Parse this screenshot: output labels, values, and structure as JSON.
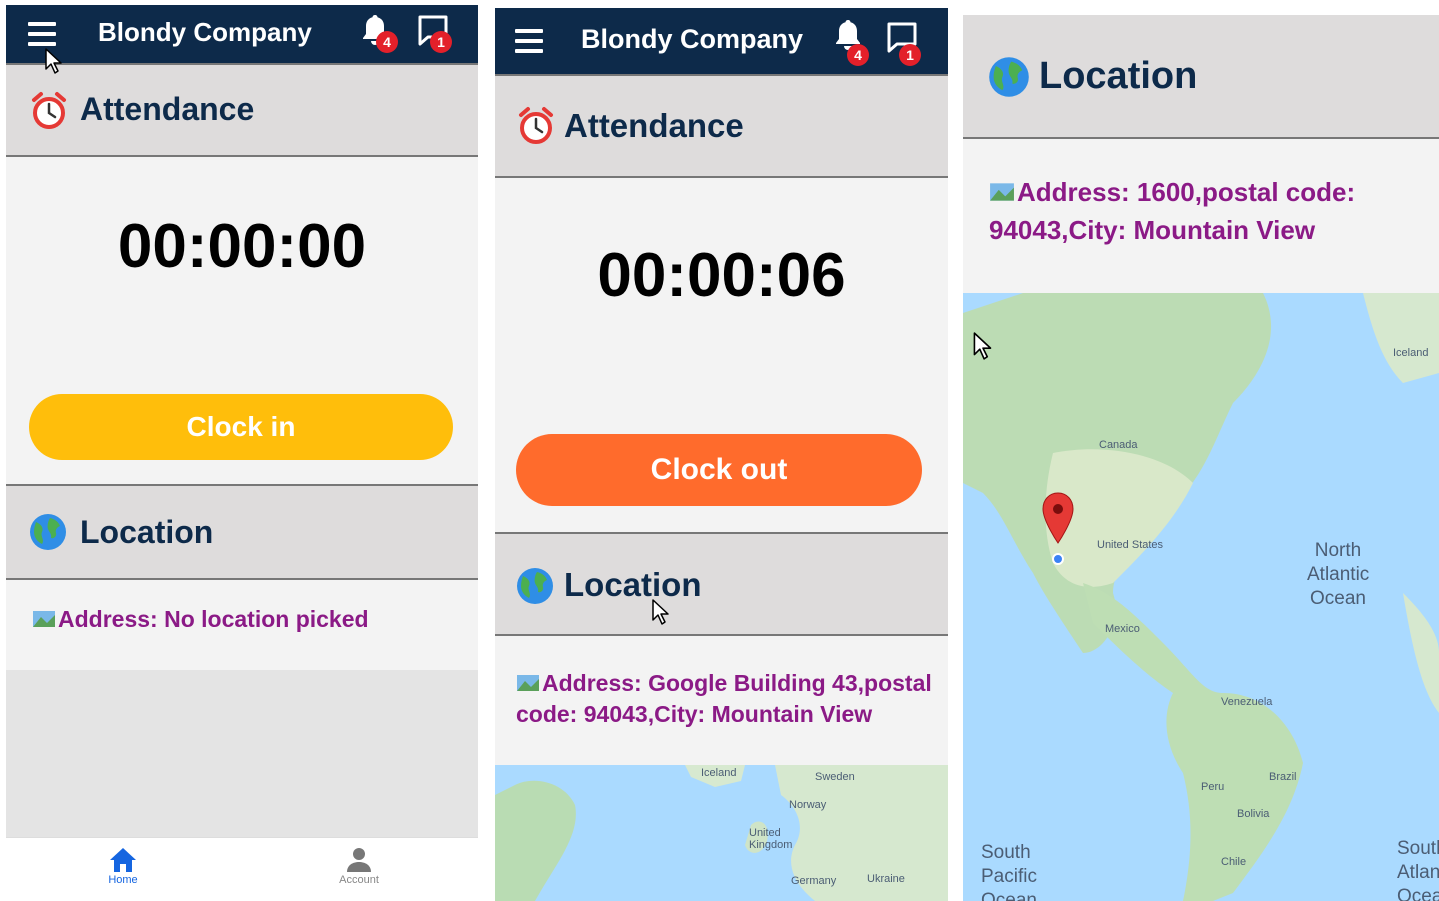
{
  "app": {
    "company": "Blondy Company"
  },
  "badges": {
    "notifications": "4",
    "messages": "1"
  },
  "attendance": {
    "title": "Attendance"
  },
  "location": {
    "title": "Location"
  },
  "screen1": {
    "timer": "00:00:00",
    "button": "Clock in",
    "address": "Address: No location picked"
  },
  "screen2": {
    "timer": "00:00:06",
    "button": "Clock out",
    "address": "Address: Google Building 43,postal code: 94043,City: Mountain View",
    "map_labels": {
      "iceland": "Iceland",
      "sweden": "Sweden",
      "norway": "Norway",
      "uk": "United Kingdom",
      "germany": "Germany",
      "ukraine": "Ukraine"
    }
  },
  "screen3": {
    "address": "Address: 1600,postal code: 94043,City: Mountain View",
    "map_labels": {
      "iceland": "Iceland",
      "canada": "Canada",
      "us": "United States",
      "mexico": "Mexico",
      "north_atlantic": "North Atlantic Ocean",
      "venezuela": "Venezuela",
      "brazil": "Brazil",
      "peru": "Peru",
      "bolivia": "Bolivia",
      "chile": "Chile",
      "south_pacific": "South Pacific Ocean",
      "south_atlantic": "South Atlantic Ocean"
    }
  },
  "nav": {
    "home": "Home",
    "account": "Account"
  },
  "icons": {
    "menu": "hamburger-menu-icon",
    "bell": "bell-icon",
    "chat": "chat-icon",
    "alarm": "alarm-clock-icon",
    "globe": "globe-icon",
    "map": "map-icon",
    "home": "home-icon",
    "account": "account-icon",
    "pin": "map-pin-icon"
  },
  "colors": {
    "appbar": "#0d2a4a",
    "clock_in": "#ffbe0b",
    "clock_out": "#ff6b2c",
    "address": "#8b1a86",
    "badge": "#e3202a",
    "nav_active": "#1565e0"
  }
}
